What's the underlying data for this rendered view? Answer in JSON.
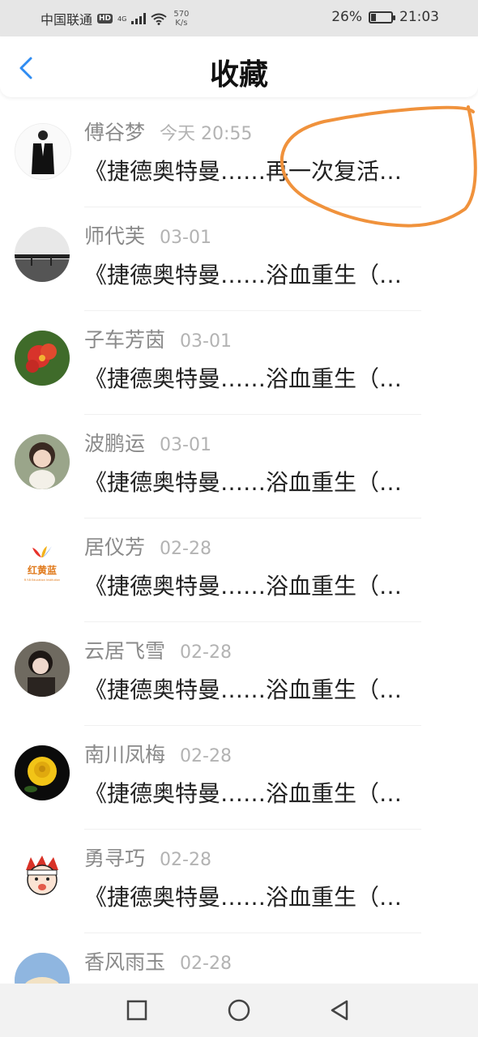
{
  "status_bar": {
    "carrier": "中国联通",
    "hd": "HD",
    "network": "4G",
    "net_speed_value": "570",
    "net_speed_unit": "K/s",
    "battery_percent": "26%",
    "battery_level": 0.26,
    "time": "21:03"
  },
  "header": {
    "title": "收藏",
    "back_icon": "chevron-left-icon"
  },
  "favorites": [
    {
      "name": "傅谷梦",
      "time": "今天 20:55",
      "title": "《捷德奥特曼……再一次复活…"
    },
    {
      "name": "师代芙",
      "time": "03-01",
      "title": "《捷德奥特曼……浴血重生（…"
    },
    {
      "name": "子车芳茵",
      "time": "03-01",
      "title": "《捷德奥特曼……浴血重生（…"
    },
    {
      "name": "波鹏运",
      "time": "03-01",
      "title": "《捷德奥特曼……浴血重生（…"
    },
    {
      "name": "居仪芳",
      "time": "02-28",
      "title": "《捷德奥特曼……浴血重生（…",
      "logo_text": "红黄蓝",
      "logo_subtext": "R.Y.B Education Institution"
    },
    {
      "name": "云居飞雪",
      "time": "02-28",
      "title": "《捷德奥特曼……浴血重生（…"
    },
    {
      "name": "南川凤梅",
      "time": "02-28",
      "title": "《捷德奥特曼……浴血重生（…"
    },
    {
      "name": "勇寻巧",
      "time": "02-28",
      "title": "《捷德奥特曼……浴血重生（…"
    },
    {
      "name": "香风雨玉",
      "time": "02-28",
      "title": ""
    }
  ],
  "bottom_nav": {
    "icons": [
      "square-icon",
      "circle-icon",
      "triangle-back-icon"
    ]
  },
  "colors": {
    "accent": "#2f8cf2",
    "annotation": "#f0923c",
    "status_bg": "#e6e6e6",
    "nav_bg": "#f2f2f2"
  }
}
